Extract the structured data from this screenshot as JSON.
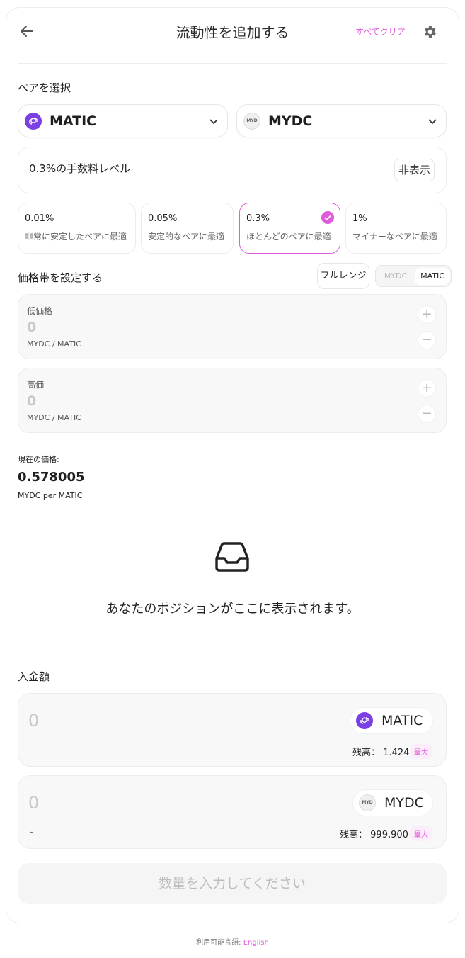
{
  "header": {
    "title": "流動性を追加する",
    "clear_all": "すべてクリア"
  },
  "pair": {
    "label": "ペアを選択",
    "token_a": "MATIC",
    "token_b": "MYDC",
    "token_b_icon_text": "MYD"
  },
  "fee": {
    "current": "0.3%の手数料レベル",
    "hide_label": "非表示",
    "tiers": [
      {
        "pct": "0.01%",
        "desc": "非常に安定したペアに最適"
      },
      {
        "pct": "0.05%",
        "desc": "安定的なペアに最適"
      },
      {
        "pct": "0.3%",
        "desc": "ほとんどのペアに最適"
      },
      {
        "pct": "1%",
        "desc": "マイナーなペアに最適"
      }
    ],
    "selected_index": 2
  },
  "range": {
    "label": "価格帯を設定する",
    "full_range": "フルレンジ",
    "toggle_a": "MYDC",
    "toggle_b": "MATIC",
    "low": {
      "label": "低価格",
      "value": "0",
      "unit": "MYDC / MATIC"
    },
    "high": {
      "label": "高価",
      "value": "0",
      "unit": "MYDC / MATIC"
    },
    "plus": "+",
    "minus": "−"
  },
  "current_price": {
    "label": "現在の価格:",
    "value": "0.578005",
    "unit": "MYDC per MATIC"
  },
  "position": {
    "empty_text": "あなたのポジションがここに表示されます。"
  },
  "deposit": {
    "label": "入金額",
    "a": {
      "placeholder": "0",
      "usd": "-",
      "token": "MATIC",
      "balance_label": "残高：",
      "balance": "1.424",
      "max": "最大"
    },
    "b": {
      "placeholder": "0",
      "usd": "-",
      "token": "MYDC",
      "icon_text": "MYD",
      "balance_label": "残高：",
      "balance": "999,900",
      "max": "最大"
    }
  },
  "submit": {
    "label": "数量を入力してください"
  },
  "footer": {
    "prefix": "利用可能言語: ",
    "language": "English"
  },
  "colors": {
    "accent": "#e05bd9",
    "matic": "#7b3fe4"
  }
}
